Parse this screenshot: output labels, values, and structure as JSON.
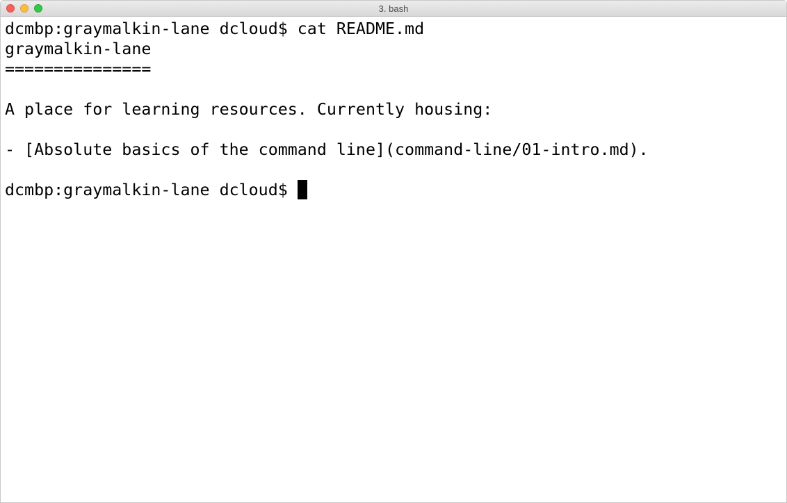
{
  "window": {
    "title": "3. bash"
  },
  "terminal": {
    "lines": [
      "dcmbp:graymalkin-lane dcloud$ cat README.md",
      "graymalkin-lane",
      "===============",
      "",
      "A place for learning resources. Currently housing:",
      "",
      "- [Absolute basics of the command line](command-line/01-intro.md).",
      ""
    ],
    "prompt": "dcmbp:graymalkin-lane dcloud$ "
  }
}
